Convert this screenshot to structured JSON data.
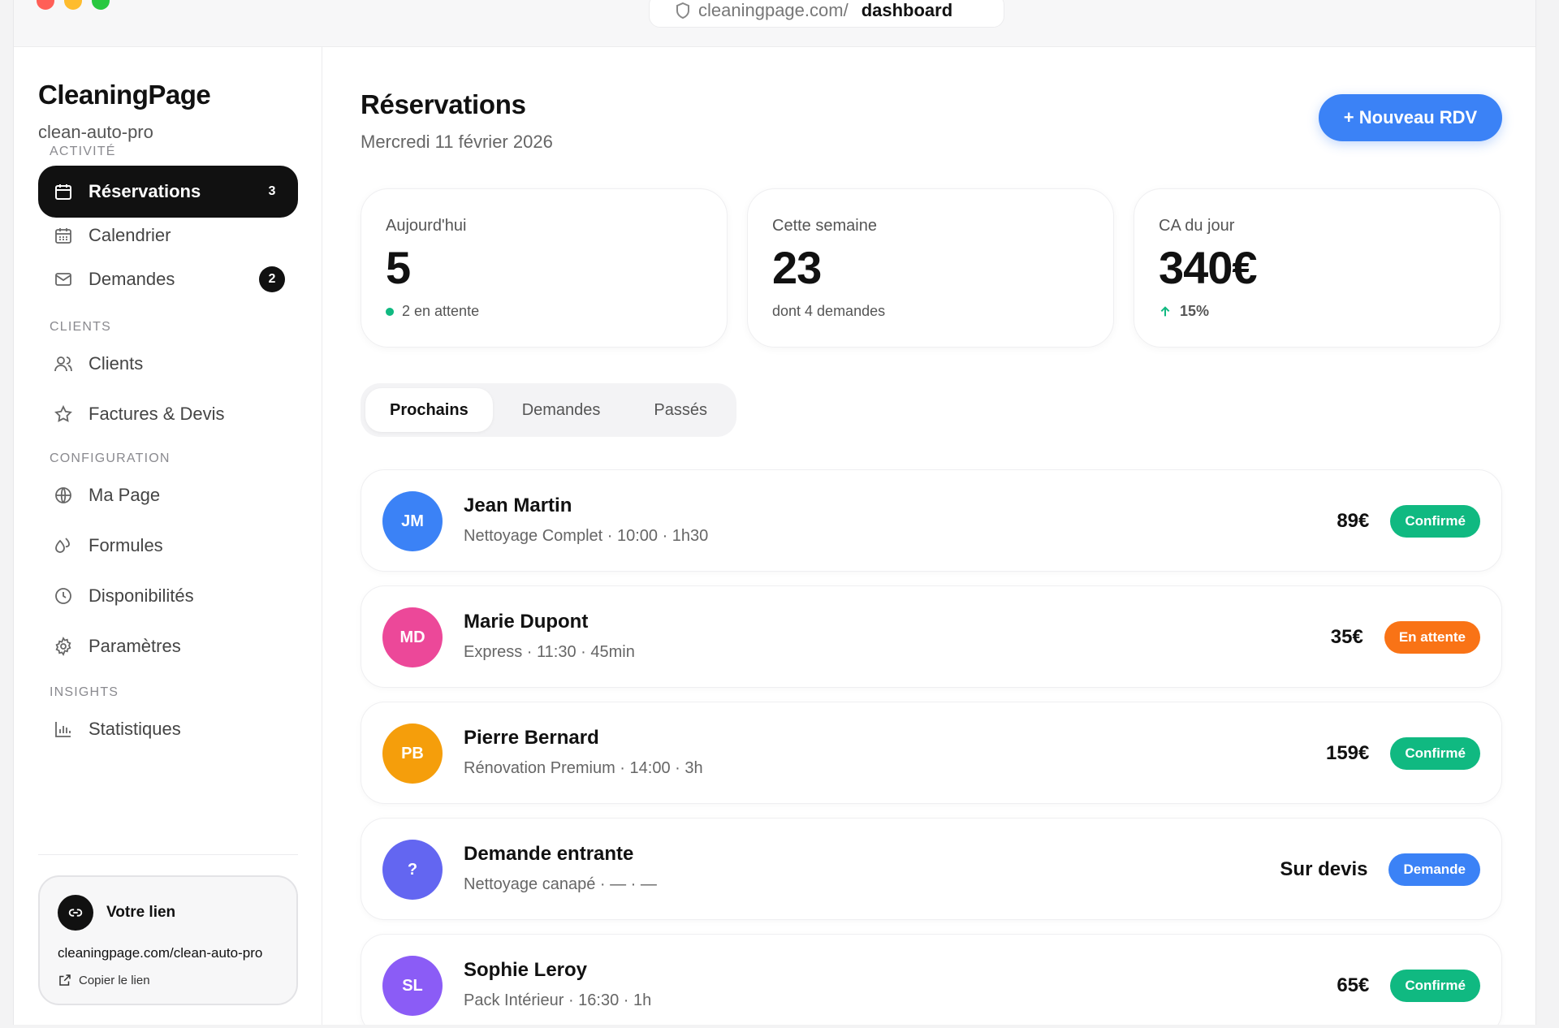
{
  "browser": {
    "url_host": "cleaningpage.com/",
    "url_path": "dashboard"
  },
  "sidebar": {
    "brand": "CleaningPage",
    "subtitle": "clean-auto-pro",
    "sections": {
      "activity": "ACTIVITÉ",
      "clients": "CLIENTS",
      "configuration": "CONFIGURATION",
      "insights": "INSIGHTS"
    },
    "items": {
      "reservations": {
        "label": "Réservations",
        "badge": "3",
        "icon": "calendar-icon"
      },
      "calendrier": {
        "label": "Calendrier",
        "icon": "calendar-grid-icon"
      },
      "demandes": {
        "label": "Demandes",
        "badge": "2",
        "icon": "mail-icon"
      },
      "clients": {
        "label": "Clients",
        "icon": "users-icon"
      },
      "factures": {
        "label": "Factures & Devis",
        "icon": "star-icon"
      },
      "mapage": {
        "label": "Ma Page",
        "icon": "globe-icon"
      },
      "formules": {
        "label": "Formules",
        "icon": "droplets-icon"
      },
      "disponibilites": {
        "label": "Disponibilités",
        "icon": "clock-icon"
      },
      "parametres": {
        "label": "Paramètres",
        "icon": "gear-icon"
      },
      "statistiques": {
        "label": "Statistiques",
        "icon": "bar-chart-icon"
      }
    },
    "link_card": {
      "title": "Votre lien",
      "url": "cleaningpage.com/clean-auto-pro",
      "copy_label": "Copier le lien"
    }
  },
  "header": {
    "title": "Réservations",
    "date": "Mercredi 11 février 2026",
    "new_button": "+ Nouveau RDV"
  },
  "stats": [
    {
      "label": "Aujourd'hui",
      "value": "5",
      "foot": "2 en attente"
    },
    {
      "label": "Cette semaine",
      "value": "23",
      "foot": "dont 4 demandes"
    },
    {
      "label": "CA du jour",
      "value": "340€",
      "foot": "15%"
    }
  ],
  "tabs": [
    "Prochains",
    "Demandes",
    "Passés"
  ],
  "reservations": [
    {
      "initials": "JM",
      "name": "Jean Martin",
      "detail": "Nettoyage Complet · 10:00 · 1h30",
      "price": "89€",
      "status": "Confirmé",
      "avatar_color": "#3b82f6",
      "status_color": "#10b981"
    },
    {
      "initials": "MD",
      "name": "Marie Dupont",
      "detail": "Express · 11:30 · 45min",
      "price": "35€",
      "status": "En attente",
      "avatar_color": "#ec4899",
      "status_color": "#f97316"
    },
    {
      "initials": "PB",
      "name": "Pierre Bernard",
      "detail": "Rénovation Premium · 14:00 · 3h",
      "price": "159€",
      "status": "Confirmé",
      "avatar_color": "#f59e0b",
      "status_color": "#10b981"
    },
    {
      "initials": "?",
      "name": "Demande entrante",
      "detail": "Nettoyage canapé · — · —",
      "price": "Sur devis",
      "status": "Demande",
      "avatar_color": "#6366f1",
      "status_color": "#3b82f6"
    },
    {
      "initials": "SL",
      "name": "Sophie Leroy",
      "detail": "Pack Intérieur · 16:30 · 1h",
      "price": "65€",
      "status": "Confirmé",
      "avatar_color": "#8b5cf6",
      "status_color": "#10b981"
    }
  ]
}
